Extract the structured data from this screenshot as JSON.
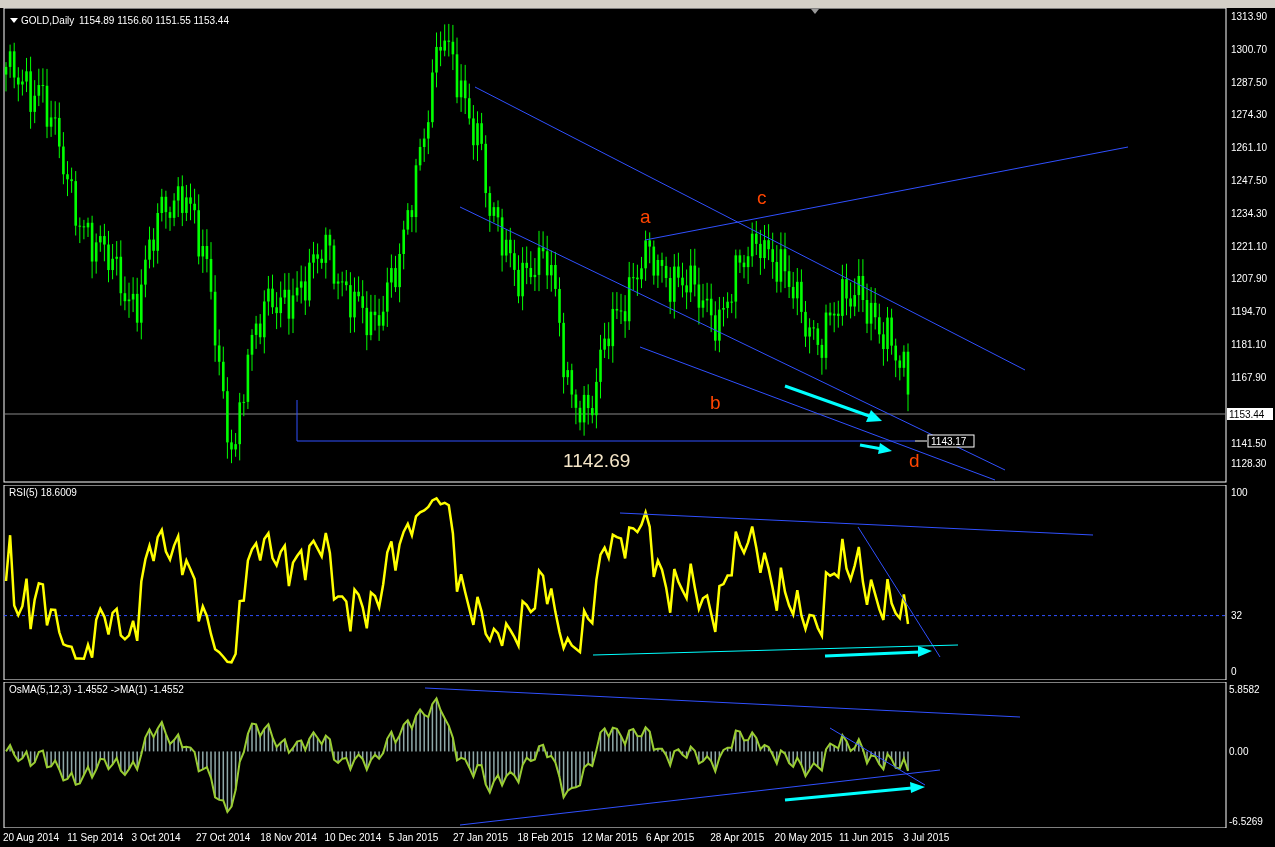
{
  "main_chart": {
    "symbol": "GOLD,Daily",
    "ohlc": [
      "1154.89",
      "1156.60",
      "1151.55",
      "1153.44"
    ],
    "price_axis": [
      "1313.90",
      "1300.70",
      "1287.50",
      "1274.30",
      "1261.10",
      "1247.50",
      "1234.30",
      "1221.10",
      "1207.90",
      "1194.70",
      "1181.10",
      "1167.90",
      "1141.50",
      "1128.30"
    ],
    "current_price": "1153.44",
    "line_price_label": "1143.17",
    "low_label": "1142.69",
    "wave_labels": [
      {
        "text": "a"
      },
      {
        "text": "b"
      },
      {
        "text": "c"
      },
      {
        "text": "d"
      }
    ]
  },
  "rsi_panel": {
    "title": "RSI(5) 18.6009",
    "axis": [
      "100",
      "32",
      "0"
    ]
  },
  "osma_panel": {
    "title": "OsMA(5,12,3) -1.4552  ->MA(1) -1.4552",
    "axis": [
      "5.8582",
      "0.00",
      "-6.5269"
    ]
  },
  "date_axis": [
    "20 Aug 2014",
    "11 Sep 2014",
    "3 Oct 2014",
    "27 Oct 2014",
    "18 Nov 2014",
    "10 Dec 2014",
    "5 Jan 2015",
    "27 Jan 2015",
    "18 Feb 2015",
    "12 Mar 2015",
    "6 Apr 2015",
    "28 Apr 2015",
    "20 May 2015",
    "11 Jun 2015",
    "3 Jul 2015"
  ]
}
